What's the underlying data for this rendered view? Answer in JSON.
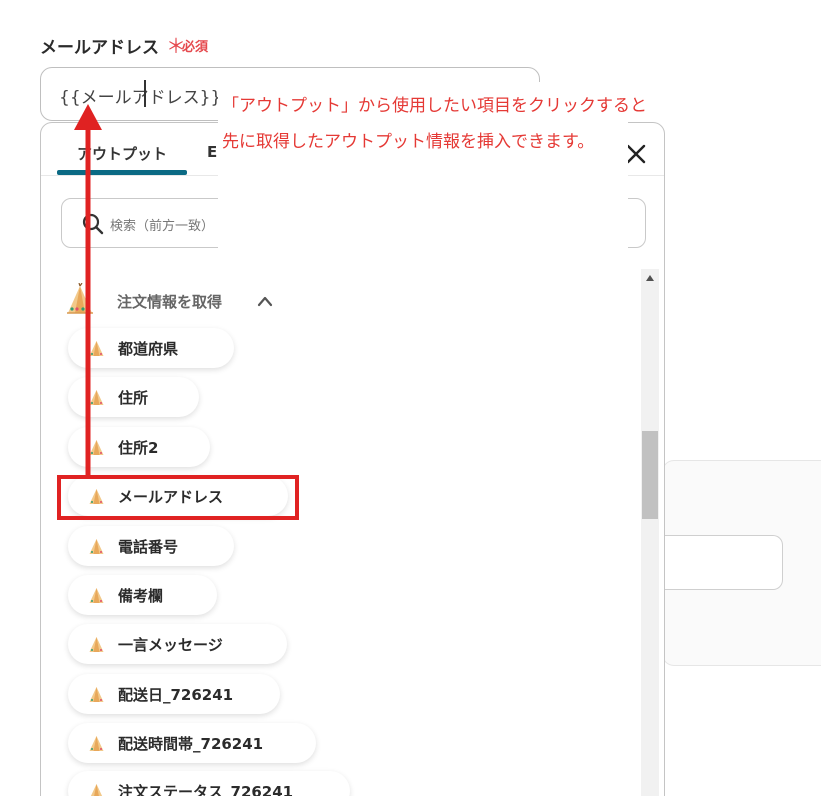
{
  "field": {
    "label": "メールアドレス",
    "required_mark": "＊",
    "required_text": "必須",
    "value": "{{メールアドレス}}"
  },
  "popup": {
    "tabs": [
      {
        "label": "アウトプット",
        "active": true
      },
      {
        "label": "E",
        "active": false
      }
    ],
    "close_icon": "close-icon",
    "search": {
      "placeholder": "検索（前方一致）"
    },
    "section": {
      "title": "注文情報を取得",
      "icon": "tent-icon",
      "expanded": true
    },
    "items": [
      {
        "label": "都道府県"
      },
      {
        "label": "住所"
      },
      {
        "label": "住所2"
      },
      {
        "label": "メールアドレス"
      },
      {
        "label": "電話番号"
      },
      {
        "label": "備考欄"
      },
      {
        "label": "一言メッセージ"
      },
      {
        "label": "配送日_726241"
      },
      {
        "label": "配送時間帯_726241"
      },
      {
        "label": "注文ステータス_726241"
      }
    ]
  },
  "annotation": {
    "line1": "「アウトプット」から使用したい項目をクリックすると",
    "line2": "先に取得したアウトプット情報を挿入できます。",
    "color": "#e53935"
  },
  "colors": {
    "accent": "#0b6a84",
    "required": "#e5484d",
    "highlight": "#e02222"
  }
}
